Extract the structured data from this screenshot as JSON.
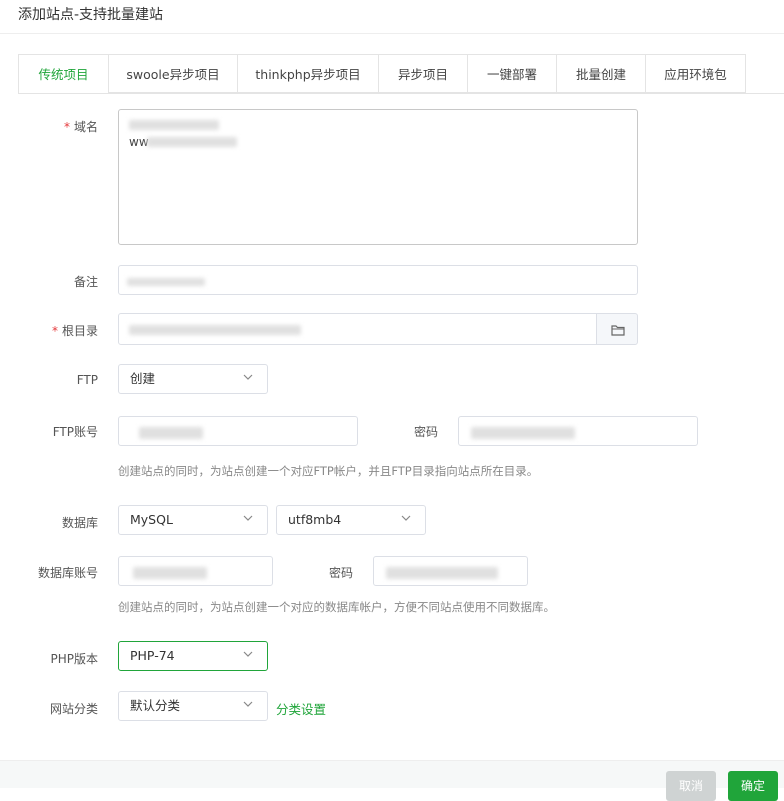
{
  "dialog": {
    "title": "添加站点-支持批量建站"
  },
  "tabs": [
    {
      "label": "传统项目",
      "active": true
    },
    {
      "label": "swoole异步项目"
    },
    {
      "label": "thinkphp异步项目"
    },
    {
      "label": "异步项目"
    },
    {
      "label": "一键部署"
    },
    {
      "label": "批量创建"
    },
    {
      "label": "应用环境包"
    }
  ],
  "form": {
    "domain": {
      "label": "域名",
      "value": "ww"
    },
    "remark": {
      "label": "备注"
    },
    "root_dir": {
      "label": "根目录"
    },
    "ftp": {
      "label": "FTP",
      "selected": "创建"
    },
    "ftp_account": {
      "label": "FTP账号",
      "password_label": "密码",
      "hint": "创建站点的同时，为站点创建一个对应FTP帐户，并且FTP目录指向站点所在目录。"
    },
    "database": {
      "label": "数据库",
      "type_selected": "MySQL",
      "charset_selected": "utf8mb4"
    },
    "db_account": {
      "label": "数据库账号",
      "password_label": "密码",
      "hint": "创建站点的同时，为站点创建一个对应的数据库帐户，方便不同站点使用不同数据库。"
    },
    "php_version": {
      "label": "PHP版本",
      "selected": "PHP-74"
    },
    "site_category": {
      "label": "网站分类",
      "selected": "默认分类",
      "settings_link": "分类设置"
    }
  },
  "footer": {
    "cancel_label": "取消",
    "confirm_label": "确定"
  },
  "colors": {
    "accent": "#20a53a",
    "required": "#e4393c"
  }
}
